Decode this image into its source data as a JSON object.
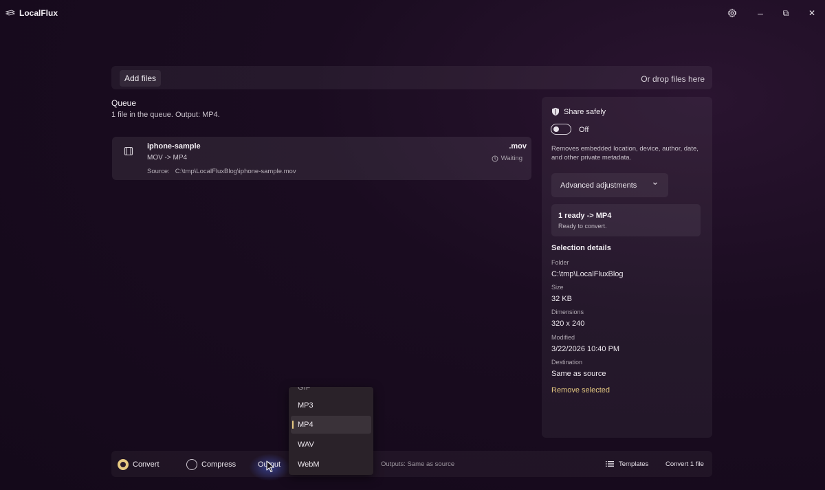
{
  "app": {
    "title": "LocalFlux"
  },
  "titlebar": {
    "settings_icon": "gear-icon",
    "minimize": "–",
    "maximize": "⧉",
    "close": "✕"
  },
  "top": {
    "add_files": "Add files",
    "drop_hint": "Or drop files here"
  },
  "queue": {
    "title": "Queue",
    "subtitle": "1 file in the queue. Output: MP4.",
    "items": [
      {
        "name": "iphone-sample",
        "conversion": "MOV -> MP4",
        "source_label": "Source:",
        "source_path": "C:\\tmp\\LocalFluxBlog\\iphone-sample.mov",
        "extension": ".mov",
        "status": "Waiting"
      }
    ]
  },
  "panel": {
    "share_title": "Share safely",
    "toggle_state": "Off",
    "share_desc": "Removes embedded location, device, author, date, and other private metadata.",
    "advanced": "Advanced adjustments",
    "ready_title": "1 ready -> MP4",
    "ready_sub": "Ready to convert.",
    "selection_title": "Selection details",
    "details": [
      {
        "label": "Folder",
        "value": "C:\\tmp\\LocalFluxBlog"
      },
      {
        "label": "Size",
        "value": "32 KB"
      },
      {
        "label": "Dimensions",
        "value": "320 x 240"
      },
      {
        "label": "Modified",
        "value": "3/22/2026 10:40 PM"
      },
      {
        "label": "Destination",
        "value": "Same as source"
      }
    ],
    "remove_selected": "Remove selected"
  },
  "bottom": {
    "mode_convert": "Convert",
    "mode_compress": "Compress",
    "selected_mode": "Convert",
    "output_label": "Output",
    "outputs_note": "Outputs: Same as source",
    "templates": "Templates",
    "convert_button": "Convert 1 file"
  },
  "dropdown": {
    "partial_item": "GIF",
    "options": [
      "MP3",
      "MP4",
      "WAV",
      "WebM"
    ],
    "selected": "MP4"
  },
  "colors": {
    "accent": "#e6c982",
    "background": "#1a0c20"
  }
}
